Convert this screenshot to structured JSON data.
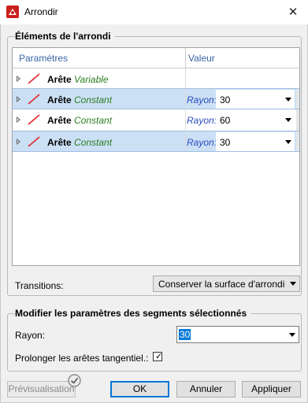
{
  "window": {
    "title": "Arrondir",
    "close_label": "✕"
  },
  "elements_group": {
    "title": "Éléments de l'arrondi"
  },
  "table": {
    "headers": [
      "Paramètres",
      "Valeur"
    ],
    "rows": [
      {
        "label": "Arête",
        "type": "Variable",
        "selected": false,
        "rayon_label": "",
        "value": ""
      },
      {
        "label": "Arête",
        "type": "Constant",
        "selected": true,
        "rayon_label": "Rayon:",
        "value": "30"
      },
      {
        "label": "Arête",
        "type": "Constant",
        "selected": false,
        "rayon_label": "Rayon:",
        "value": "60"
      },
      {
        "label": "Arête",
        "type": "Constant",
        "selected": true,
        "rayon_label": "Rayon:",
        "value": "30"
      }
    ]
  },
  "transitions": {
    "label": "Transitions:",
    "value": "Conserver la surface d'arrondi"
  },
  "modify_group": {
    "title": "Modifier les paramètres des segments sélectionnés",
    "rayon_label": "Rayon:",
    "rayon_value": "30",
    "extend_label": "Prolonger les arêtes tangentiel.:",
    "extend_checked": true
  },
  "buttons": {
    "preview": "Prévisualisation",
    "ok": "OK",
    "cancel": "Annuler",
    "apply": "Appliquer"
  }
}
